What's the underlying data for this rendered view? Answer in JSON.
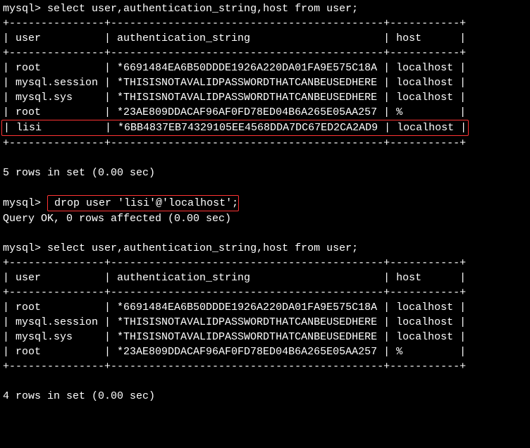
{
  "prompt": "mysql> ",
  "query1": "select user,authentication_string,host from user;",
  "sep1": "+---------------+-------------------------------------------+-----------+",
  "header1": "| user          | authentication_string                     | host      |",
  "rows1": [
    "| root          | *6691484EA6B50DDDE1926A220DA01FA9E575C18A | localhost |",
    "| mysql.session | *THISISNOTAVALIDPASSWORDTHATCANBEUSEDHERE | localhost |",
    "| mysql.sys     | *THISISNOTAVALIDPASSWORDTHATCANBEUSEDHERE | localhost |",
    "| root          | *23AE809DDACAF96AF0FD78ED04B6A265E05AA257 | %         |",
    "| lisi          | *6BB4837EB74329105EE4568DDA7DC67ED2CA2AD9 | localhost |"
  ],
  "result1": "5 rows in set (0.00 sec)",
  "query2": "drop user 'lisi'@'localhost';",
  "result2": "Query OK, 0 rows affected (0.00 sec)",
  "query3": "select user,authentication_string,host from user;",
  "rows3": [
    "| root          | *6691484EA6B50DDDE1926A220DA01FA9E575C18A | localhost |",
    "| mysql.session | *THISISNOTAVALIDPASSWORDTHATCANBEUSEDHERE | localhost |",
    "| mysql.sys     | *THISISNOTAVALIDPASSWORDTHATCANBEUSEDHERE | localhost |",
    "| root          | *23AE809DDACAF96AF0FD78ED04B6A265E05AA257 | %         |"
  ],
  "result3": "4 rows in set (0.00 sec)"
}
